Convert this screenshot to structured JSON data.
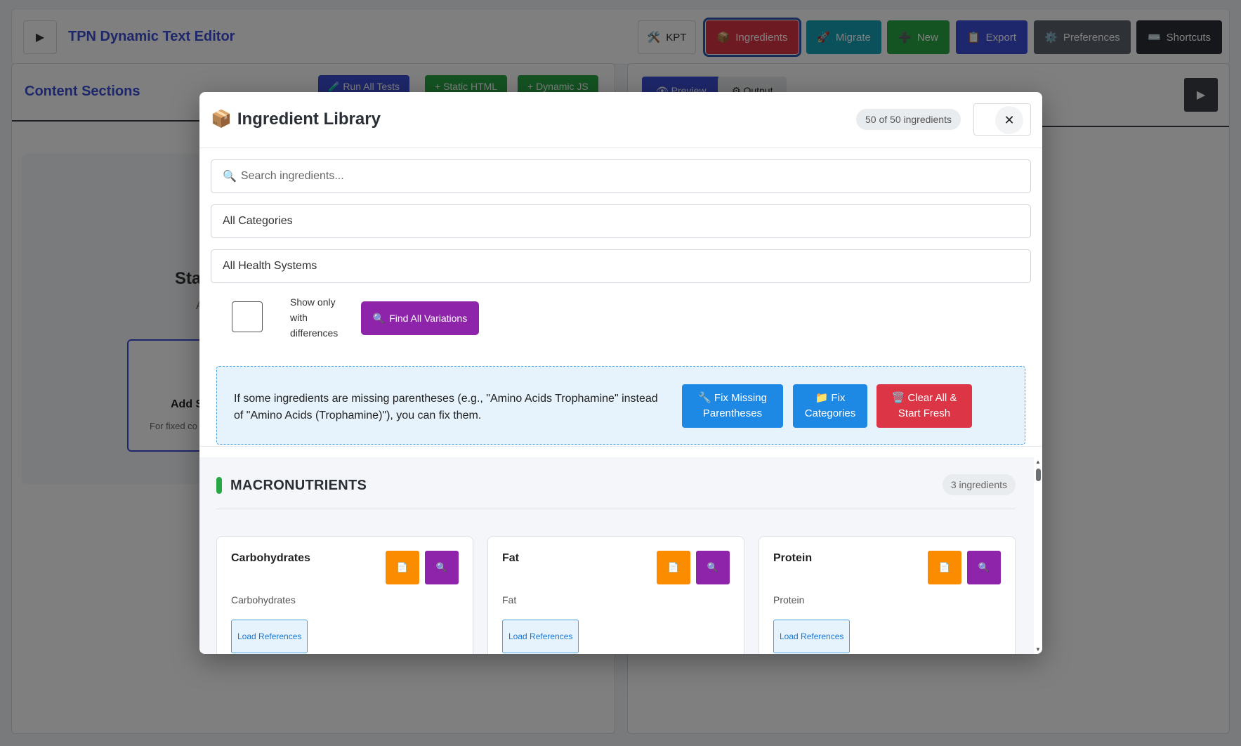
{
  "app": {
    "title": "TPN Dynamic Text Editor",
    "toggle_icon": "▶",
    "toolbar": [
      {
        "label": "KPT",
        "icon": "🛠️",
        "color": "#ffffff"
      },
      {
        "label": "Ingredients",
        "icon": "📦",
        "color": "#dc3545"
      },
      {
        "label": "Migrate",
        "icon": "🚀",
        "color": "#17a2b8"
      },
      {
        "label": "New",
        "icon": "➕",
        "color": "#28a745"
      },
      {
        "label": "Export",
        "icon": "📋",
        "color": "#3d4fd6"
      },
      {
        "label": "Preferences",
        "icon": "⚙️",
        "color": "#5c636a"
      },
      {
        "label": "Shortcuts",
        "icon": "⌨️",
        "color": "#2a2f36"
      }
    ],
    "left_panel": {
      "title": "Content Sections",
      "buttons": [
        {
          "label": "🧪 Run All Tests",
          "color": "#3d4fd6"
        },
        {
          "label": "+ Static HTML",
          "color": "#28a745"
        },
        {
          "label": "+ Dynamic JS",
          "color": "#28a745"
        }
      ],
      "empty_title": "Sta",
      "empty_sub": "A",
      "add_card_title": "Add S",
      "add_card_sub": "For fixed co"
    },
    "right_panel": {
      "tabs": [
        {
          "label": "👁 Preview",
          "color": "#3d4fd6"
        },
        {
          "label": "⚙ Output",
          "color": "#e9ecef"
        }
      ],
      "toggle_icon": "▶"
    }
  },
  "modal": {
    "icon": "📦",
    "title": "Ingredient Library",
    "count": "50 of 50 ingredients",
    "close_icon": "✕",
    "search": {
      "icon": "🔍",
      "placeholder": "Search ingredients..."
    },
    "category_select": "All Categories",
    "health_system_select": "All Health Systems",
    "checkbox_label": "Show only with differences",
    "find_variations": {
      "icon": "🔍",
      "label": "Find All Variations"
    },
    "notice": {
      "text": "If some ingredients are missing parentheses (e.g., \"Amino Acids Trophamine\" instead of \"Amino Acids (Trophamine)\"), you can fix them.",
      "buttons": [
        {
          "icon": "🔧",
          "label": "Fix Missing Parentheses",
          "color": "#1e88e5"
        },
        {
          "icon": "📁",
          "label": "Fix Categories",
          "color": "#1e88e5"
        },
        {
          "icon": "🗑️",
          "label": "Clear All & Start Fresh",
          "color": "#dc3545"
        }
      ]
    },
    "category": {
      "name": "MACRONUTRIENTS",
      "count": "3 ingredients",
      "color": "#28a745"
    },
    "ingredients": [
      {
        "name": "Carbohydrates",
        "sub": "Carbohydrates",
        "load": "Load References"
      },
      {
        "name": "Fat",
        "sub": "Fat",
        "load": "Load References"
      },
      {
        "name": "Protein",
        "sub": "Protein",
        "load": "Load References"
      }
    ],
    "card_icons": {
      "doc": "📄",
      "find": "🔍"
    }
  }
}
